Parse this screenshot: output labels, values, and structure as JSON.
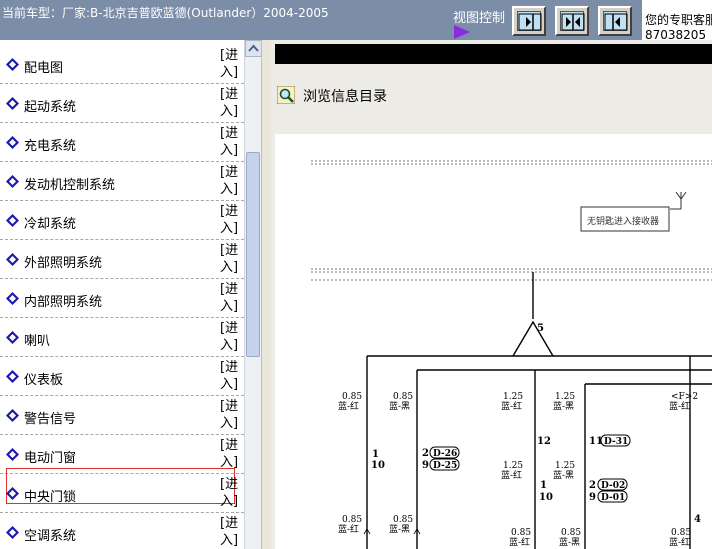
{
  "header": {
    "vehicle_label": "当前车型：厂家:B-北京吉普欧蓝德(Outlander）2004-2005",
    "view_control_label": "视图控制",
    "help_line1": "您的专职客服",
    "help_line2": "87038205"
  },
  "systems": [
    {
      "name": "配电图",
      "action": "[进入]"
    },
    {
      "name": "起动系统",
      "action": "[进入]"
    },
    {
      "name": "充电系统",
      "action": "[进入]"
    },
    {
      "name": "发动机控制系统",
      "action": "[进入]"
    },
    {
      "name": "冷却系统",
      "action": "[进入]"
    },
    {
      "name": "外部照明系统",
      "action": "[进入]"
    },
    {
      "name": "内部照明系统",
      "action": "[进入]"
    },
    {
      "name": "喇叭",
      "action": "[进入]"
    },
    {
      "name": "仪表板",
      "action": "[进入]"
    },
    {
      "name": "警告信号",
      "action": "[进入]"
    },
    {
      "name": "电动门窗",
      "action": "[进入]"
    },
    {
      "name": "中央门锁",
      "action": "[进入]",
      "selected": true
    },
    {
      "name": "空调系统",
      "action": "[进入]"
    }
  ],
  "content": {
    "browse_title": "浏览信息目录"
  },
  "diagram": {
    "receiver_label": "无钥匙进入接收器",
    "node_number": "5",
    "wires_top": [
      {
        "gauge": "0.85",
        "color": "蓝-红"
      },
      {
        "gauge": "0.85",
        "color": "蓝-黑"
      },
      {
        "gauge": "1.25",
        "color": "蓝-红"
      },
      {
        "gauge": "1.25",
        "color": "蓝-黑"
      },
      {
        "gauge": "<F>2",
        "color": "蓝-红"
      }
    ],
    "wires_mid": [
      {
        "gauge": "1.25",
        "color": "蓝-红"
      },
      {
        "gauge": "1.25",
        "color": "蓝-黑"
      }
    ],
    "wires_bottom": [
      {
        "gauge": "0.85",
        "color": "蓝-红"
      },
      {
        "gauge": "0.85",
        "color": "蓝-黑"
      },
      {
        "gauge": "0.85",
        "color": "蓝-红"
      },
      {
        "gauge": "0.85",
        "color": "蓝-黑"
      },
      {
        "gauge": "0.85",
        "color": "蓝-红"
      }
    ],
    "pins": {
      "p1a": "1",
      "p10a": "10",
      "p2": "2",
      "p9a": "9",
      "p12": "12",
      "p11": "11",
      "p1b": "1",
      "p10b": "10",
      "p2b": "2",
      "p9b": "9",
      "p4": "4"
    },
    "connectors": {
      "d26": "D-26",
      "d25": "D-25",
      "d31": "D-31",
      "d02": "D-02",
      "d01": "D-01"
    }
  },
  "colors": {
    "header_bg": "#7b8da7",
    "selection_border": "#e03030",
    "bullet_blue": "#1a1aa8",
    "play_arrow": "#8a2be2"
  }
}
